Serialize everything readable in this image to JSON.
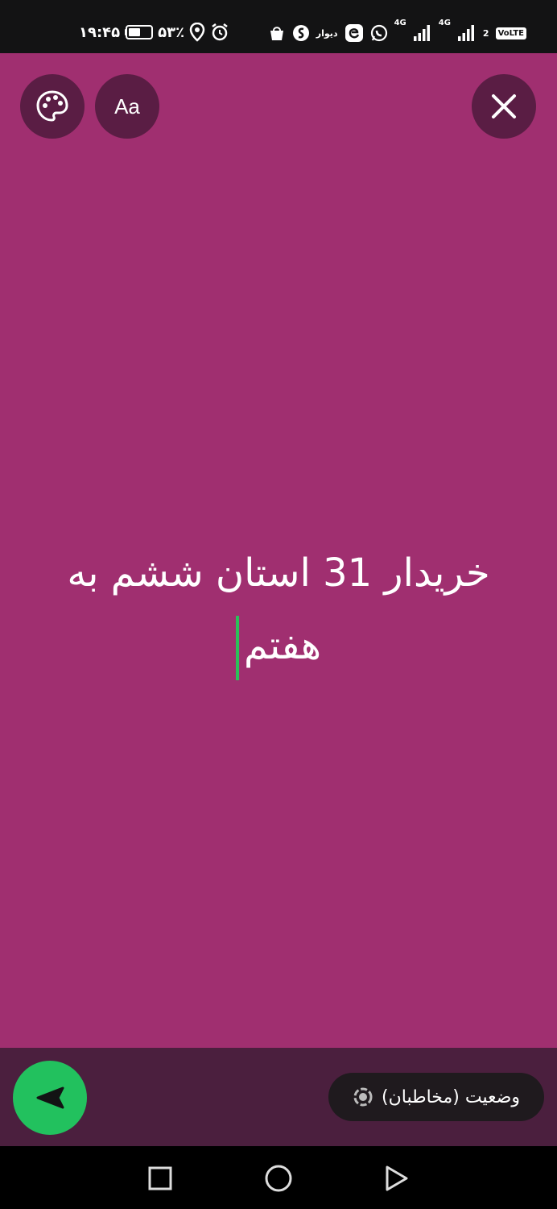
{
  "status_bar": {
    "time": "۱۹:۴۵",
    "battery_percent": "۵۳٪",
    "battery_level": 0.53,
    "network_label_1": "4G",
    "network_label_2": "4G",
    "sim_number": "2",
    "volte": "VoLTE",
    "divar_label": "دیوار"
  },
  "toolbar": {
    "font_button_label": "Aa"
  },
  "story": {
    "line1": "خریدار 31 استان ششم به",
    "line2": "هفتم"
  },
  "bottom_bar": {
    "status_audience_label": "وضعیت (مخاطبان)"
  },
  "colors": {
    "canvas_background": "#a02f70",
    "button_background": "#5a1d44",
    "bottom_bar": "#4b1f3e",
    "send_button": "#22c15e",
    "caret": "#2bbf5a"
  }
}
